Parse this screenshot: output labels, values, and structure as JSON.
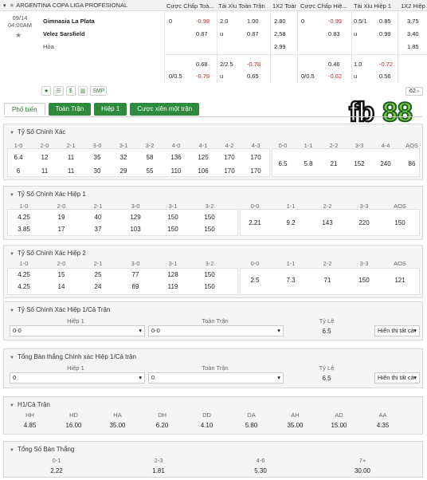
{
  "league": "ARGENTINA COPA LIGA PROFESIONAL",
  "columns": [
    "Cược Chấp Toà...",
    "Tài Xỉu Toàn Trận",
    "1X2 Toàn...",
    "Cược Chấp Hiệ...",
    "Tài Xỉu Hiệp 1",
    "1X2 Hiệp 1"
  ],
  "match": {
    "date": "09/14",
    "time": "04:00AM",
    "home": "Gimnasia La Plata",
    "away": "Velez Sarsfield",
    "draw": "Hòa"
  },
  "odds_rows": [
    [
      "0",
      "-0.98",
      "2.0",
      "1.00",
      "2.80",
      "0",
      "-0.99",
      "0.5/1",
      "0.85",
      "3.75"
    ],
    [
      "",
      "0.87",
      "u",
      "0.87",
      "2.58",
      "",
      "0.83",
      "u",
      "0.99",
      "3.40"
    ],
    [
      "",
      "",
      "",
      "",
      "2.99",
      "",
      "",
      "",
      "",
      "1.85"
    ]
  ],
  "odds_rows2": [
    [
      "",
      "0.68",
      "2/2.5",
      "-0.78",
      "",
      "",
      "0.46",
      "1.0",
      "-0.72",
      ""
    ],
    [
      "0/0.5",
      "-0.79",
      "u",
      "0.65",
      "",
      "0/0.5",
      "-0.62",
      "u",
      "0.56",
      ""
    ]
  ],
  "icons": [
    "star-icon",
    "list-icon",
    "dollar-icon",
    "chart-icon",
    "SMP"
  ],
  "market_count": "62",
  "tabs": [
    "Phổ biến",
    "Toàn Trận",
    "Hiệp 1",
    "Cược xiên một trận"
  ],
  "logo": "fb88",
  "cs_full": {
    "title": "Tỷ Số Chính Xác",
    "row_headers": [
      "1-0",
      "2-0",
      "2-1",
      "3-0",
      "3-1",
      "3-2",
      "4-0",
      "4-1",
      "4-2",
      "4-3"
    ],
    "row1": [
      "6.4",
      "12",
      "11",
      "35",
      "32",
      "58",
      "136",
      "125",
      "170",
      "170"
    ],
    "row2": [
      "6",
      "11",
      "11",
      "30",
      "29",
      "55",
      "110",
      "106",
      "170",
      "170"
    ],
    "draw_headers": [
      "0-0",
      "1-1",
      "2-2",
      "3-3",
      "4-4",
      "AOS"
    ],
    "draw_vals": [
      "6.5",
      "5.8",
      "21",
      "152",
      "240",
      "86"
    ]
  },
  "cs_h1": {
    "title": "Tỷ Số Chính Xác Hiệp 1",
    "headers": [
      "1-0",
      "2-0",
      "2-1",
      "3-0",
      "3-1",
      "3-2",
      "0-0",
      "1-1",
      "2-2",
      "3-3",
      "AOS"
    ],
    "row1": [
      "4.25",
      "19",
      "40",
      "129",
      "150",
      "150"
    ],
    "row2": [
      "3.85",
      "17",
      "37",
      "103",
      "150",
      "150"
    ],
    "draw_vals": [
      "2.21",
      "9.2",
      "143",
      "220",
      "150"
    ]
  },
  "cs_h2": {
    "title": "Tỷ Số Chính Xác Hiệp 2",
    "headers": [
      "1-0",
      "2-0",
      "2-1",
      "3-0",
      "3-1",
      "3-2",
      "0-0",
      "1-1",
      "2-2",
      "3-3",
      "AOS"
    ],
    "row1": [
      "4.25",
      "15",
      "25",
      "77",
      "128",
      "150"
    ],
    "row2": [
      "4.25",
      "14",
      "24",
      "69",
      "119",
      "150"
    ],
    "draw_vals": [
      "2.5",
      "7.3",
      "71",
      "150",
      "121"
    ]
  },
  "htft_cs": {
    "title": "Tỷ Số Chính Xác Hiệp 1/Cả Trận",
    "h1": "Hiệp 1",
    "ft": "Toàn Trận",
    "odds": "Tỷ Lệ",
    "sel1": "0-0",
    "sel2": "0-0",
    "val": "6.5",
    "show": "Hiển thị tất cả"
  },
  "total_goals_htft": {
    "title": "Tổng Bàn thắng Chính xác Hiệp 1/Cả trận",
    "h1": "Hiệp 1",
    "ft": "Toàn Trận",
    "odds": "Tỷ Lệ",
    "sel1": "0",
    "sel2": "0",
    "val": "6.5",
    "show": "Hiển thị tất cả"
  },
  "h1ft": {
    "title": "H1/Cả Trận",
    "headers": [
      "HH",
      "HD",
      "HA",
      "DH",
      "DD",
      "DA",
      "AH",
      "AD",
      "AA"
    ],
    "vals": [
      "4.85",
      "16.00",
      "35.00",
      "6.20",
      "4.10",
      "5.80",
      "35.00",
      "15.00",
      "4.35"
    ]
  },
  "total_goals": {
    "title": "Tổng Số Bàn Thắng",
    "headers": [
      "0-1",
      "2-3",
      "4-6",
      "7+"
    ],
    "vals": [
      "2.22",
      "1.81",
      "5.30",
      "30.00"
    ]
  }
}
